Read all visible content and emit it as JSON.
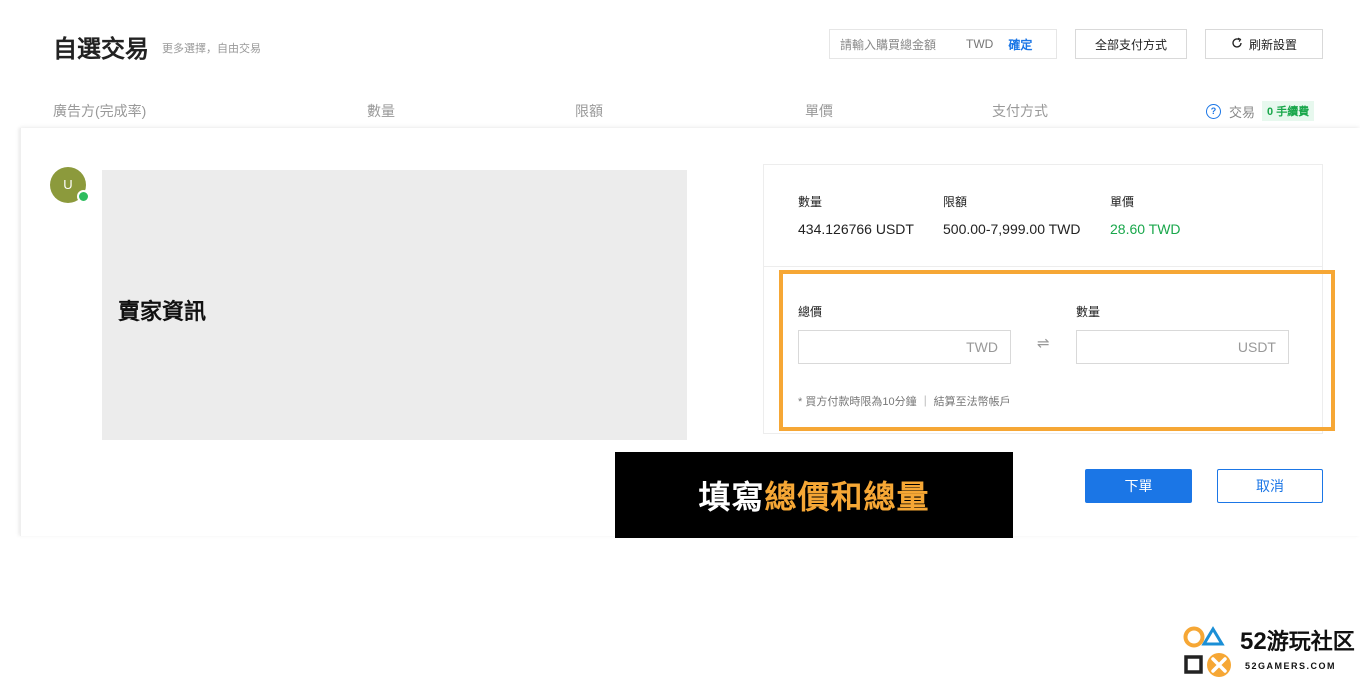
{
  "header": {
    "title": "自選交易",
    "subtitle": "更多選擇，自由交易",
    "amount_placeholder": "請輸入購買總金額",
    "amount_currency": "TWD",
    "confirm_label": "確定",
    "payment_filter_label": "全部支付方式",
    "refresh_label": "刷新設置",
    "refresh_icon": "refresh-icon"
  },
  "columns": {
    "advertiser": "廣告方(完成率)",
    "quantity": "數量",
    "limit": "限額",
    "price": "單價",
    "payment": "支付方式",
    "trade": "交易",
    "fee_badge": "0 手續費"
  },
  "seller": {
    "avatar_letter": "U",
    "info_label": "賣家資訊"
  },
  "order": {
    "quantity_label": "數量",
    "quantity_value": "434.126766 USDT",
    "limit_label": "限額",
    "limit_value": "500.00-7,999.00 TWD",
    "price_label": "單價",
    "price_value": "28.60 TWD",
    "total_label": "總價",
    "total_unit": "TWD",
    "amount_label": "數量",
    "amount_unit": "USDT",
    "swap_icon": "⇌",
    "note": "* 買方付款時限為10分鐘 ｜ 結算至法幣帳戶",
    "submit_label": "下單",
    "cancel_label": "取消"
  },
  "overlay": {
    "prefix": "填寫",
    "highlight": "總價和總量"
  },
  "watermark": {
    "number": "52",
    "name": "游玩社区",
    "domain": "52GAMERS.COM"
  },
  "colors": {
    "accent_blue": "#1b76e6",
    "price_green": "#19a74b",
    "highlight_orange": "#f6a735"
  }
}
